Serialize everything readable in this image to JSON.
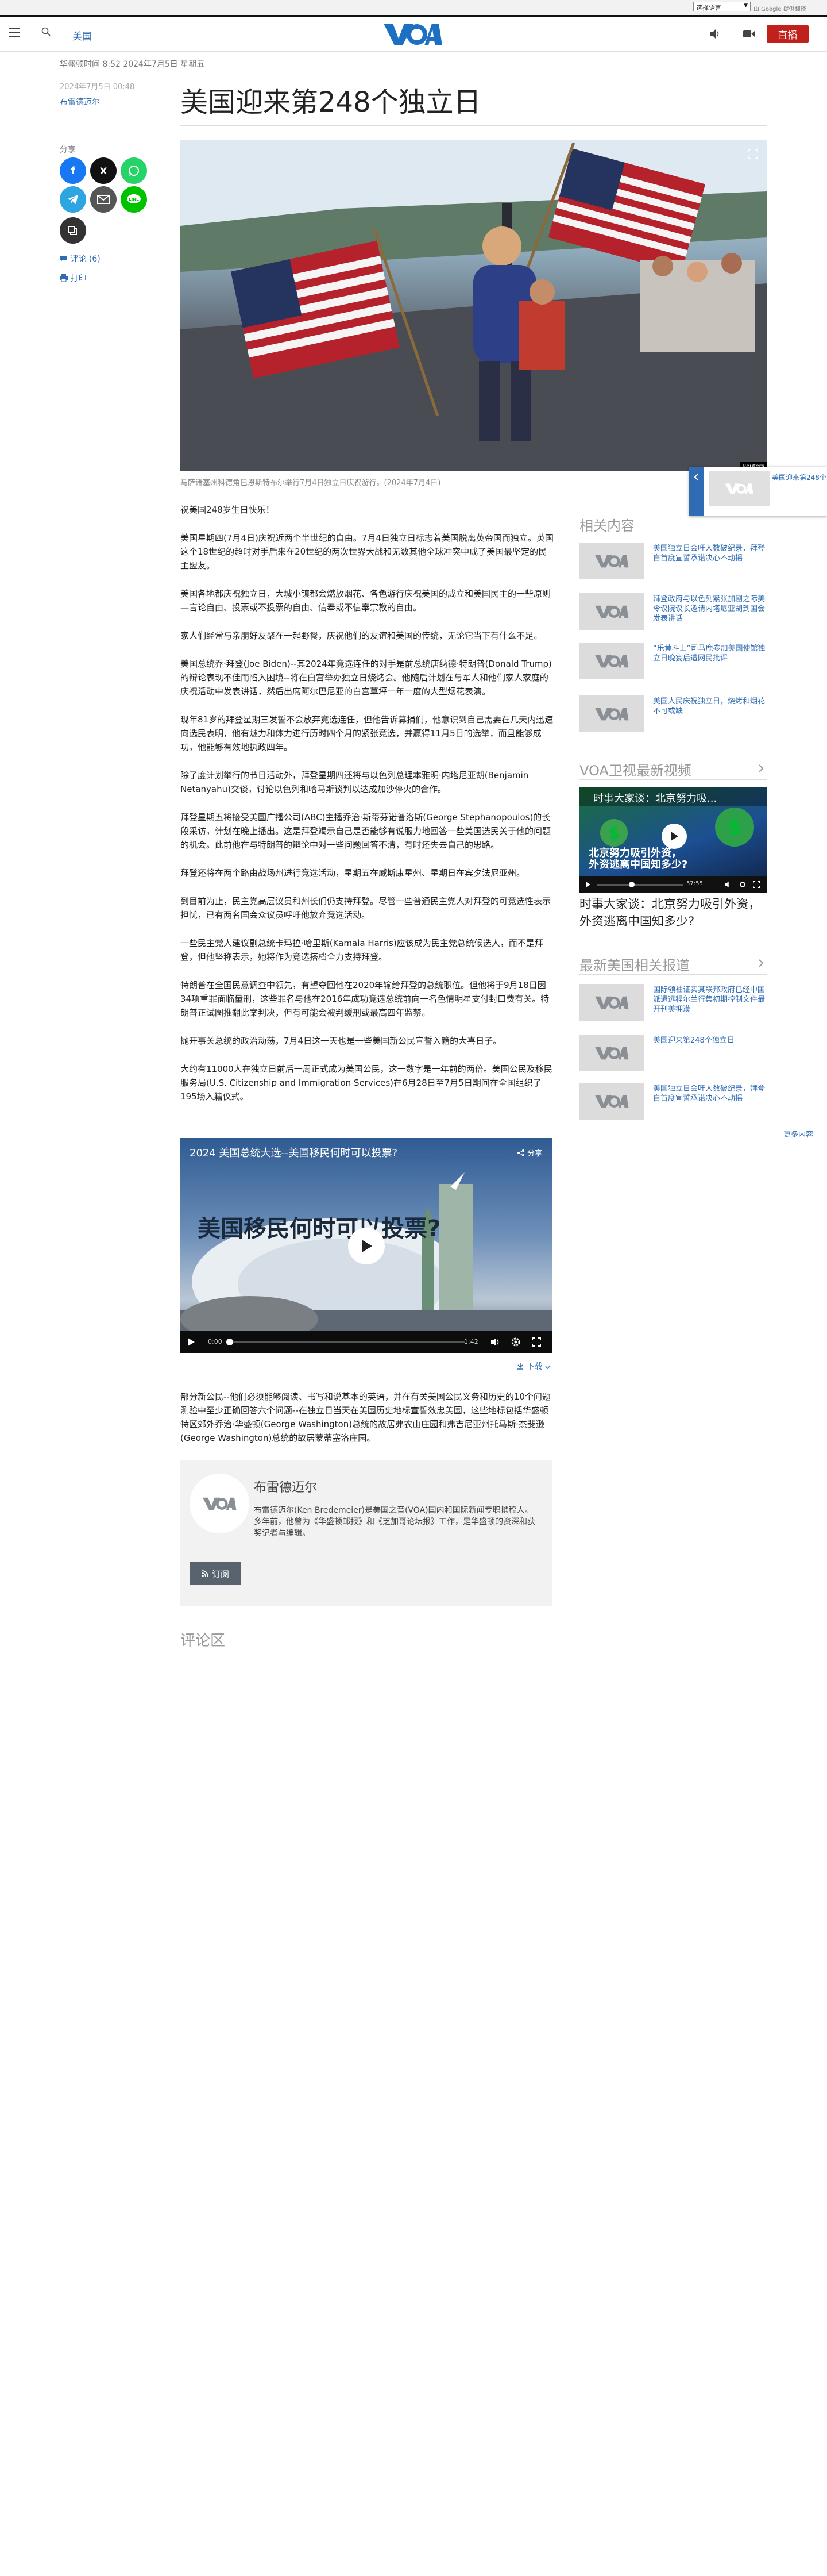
{
  "topbar": {
    "language_select": "选择语言",
    "powered_by": "由 Google 提供翻译"
  },
  "header": {
    "section": "美国",
    "live_label": "直播"
  },
  "article": {
    "meta_date": "华盛顿时间 8:52 2024年7月5日 星期五",
    "date": "2024年7月5日 00:48",
    "author": "布雷德迈尔",
    "title": "美国迎来第248个独立日",
    "share_label": "分享",
    "comments_link": "评论 (6)",
    "print_link": "打印",
    "image_caption": "马萨诸塞州科德角巴恩斯特布尔举行7月4日独立日庆祝游行。(2024年7月4日)",
    "image_credit": "Reuters",
    "paragraphs": [
      "祝美国248岁生日快乐！",
      "美国星期四(7月4日)庆祝近两个半世纪的自由。7月4日独立日标志着美国脱离英帝国而独立。英国这个18世纪的超时对手后来在20世纪的两次世界大战和无数其他全球冲突中成了美国最坚定的民主盟友。",
      "美国各地都庆祝独立日，大城小镇都会燃放烟花、各色游行庆祝美国的成立和美国民主的一些原则—言论自由、投票或不投票的自由、信奉或不信奉宗教的自由。",
      "家人们经常与亲朋好友聚在一起野餐，庆祝他们的友谊和美国的传统，无论它当下有什么不足。",
      "美国总统乔·拜登(Joe Biden)--其2024年竞选连任的对手是前总统唐纳德·特朗普(Donald Trump)的辩论表现不佳而陷入困境--将在白宫举办独立日烧烤会。他随后计划在与军人和他们家人家庭的庆祝活动中发表讲话，然后出席阿尔巴尼亚的白宫草坪一年一度的大型烟花表演。",
      "现年81岁的拜登星期三发誓不会放弃竞选连任，但他告诉募捐们，他意识到自己需要在几天内迅速向选民表明，他有魅力和体力进行历时四个月的紧张竞选，并赢得11月5日的选举，而且能够成功，他能够有效地执政四年。",
      "除了度计划举行的节日活动外，拜登星期四还将与以色列总理本雅明·内塔尼亚胡(Benjamin Netanyahu)交谈，讨论以色列和哈马斯谈判以达成加沙停火的合作。",
      "拜登星期五将接受美国广播公司(ABC)主播乔治·斯蒂芬诺普洛斯(George Stephanopoulos)的长段采访，计划在晚上播出。这是拜登竭示自己是否能够有说服力地回答一些美国选民关于他的问题的机会。此前他在与特朗普的辩论中对一些问题回答不清，有时还失去自己的思路。",
      "拜登还将在两个路由战场州进行竞选活动，星期五在威斯康星州、星期日在宾夕法尼亚州。",
      "到目前为止，民主党高层议员和州长们仍支持拜登。尽管一些普通民主党人对拜登的可竞选性表示担忧，已有两名国会众议员呼吁他放弃竞选活动。",
      "一些民主党人建议副总统卡玛拉·哈里斯(Kamala Harris)应该成为民主党总统候选人，而不是拜登，但他坚称表示，她将作为竞选搭档全力支持拜登。",
      "特朗普在全国民意调查中领先，有望夺回他在2020年输给拜登的总统职位。但他将于9月18日因34项重罪面临量刑，这些罪名与他在2016年成功竞选总统前向一名色情明星支付封口费有关。特朗普正试图推翻此案判决，但有可能会被判缓刑或最高四年监禁。",
      "抛开事关总统的政治动荡，7月4日这一天也是一些美国新公民宣誓入籍的大喜日子。",
      "大约有11000人在独立日前后一周正式成为美国公民，这一数字是一年前的两倍。美国公民及移民服务局(U.S. Citizenship and Immigration Services)在6月28日至7月5日期间在全国组织了195场入籍仪式。"
    ],
    "video_title": "2024 美国总统大选--美国移民何时可以投票?",
    "video_overlay_text": "美国移民何时可以投票?",
    "video_share": "分享",
    "video_time_start": "0:00",
    "video_time_end": "1:42",
    "download_label": "下载",
    "outro": "部分新公民--他们必须能够阅读、书写和说基本的英语，并在有关美国公民义务和历史的10个问题测验中至少正确回答六个问题--在独立日当天在美国历史地标宣誓效忠美国，这些地标包括华盛顿特区郊外乔治·华盛顿(George Washington)总统的故居弗农山庄园和弗吉尼亚州托马斯·杰斐逊(George Washington)总统的故居蒙蒂塞洛庄园。",
    "author_card": {
      "name": "布雷德迈尔",
      "bio": "布雷德迈尔(Ken Bredemeier)是美国之音(VOA)国内和国际新闻专职撰稿人。多年前，他曾为《华盛顿邮报》和《芝加哥论坛报》工作，是华盛顿的资深和获奖记者与编辑。",
      "subscribe": "订阅"
    },
    "comments_title": "评论区"
  },
  "float_card": {
    "title": "美国迎来第248个"
  },
  "sidebar": {
    "related_title": "相关内容",
    "related": [
      "美国独立日会吁人数破纪录，拜登自首度宣誓承诺决心不动摇",
      "拜登政府与以色列紧张加剧之际美令议院议长邀请内塔尼亚胡到国会发表讲话",
      "“乐黄斗士”司马鹿参加美国使馆独立日晚宴后遭网民批评",
      "美国人民庆祝独立日，烧烤和烟花不可或缺"
    ],
    "video_section_title": "VOA卫视最新视频",
    "video": {
      "banner": "时事大家谈：北京努力吸...",
      "overlay_line1": "北京努力吸引外资，",
      "overlay_line2": "外资逃离中国知多少?",
      "time": "57:55",
      "caption": "时事大家谈：北京努力吸引外资，外资逃离中国知多少?"
    },
    "latest_title": "最新美国相关报道",
    "latest": [
      "国际领袖证实其联邦政府已经中国派遣远程尔兰行集初期控制文件最开刊美拥漠",
      "美国迎来第248个独立日",
      "美国独立日会吁人数破纪录，拜登自首度宣誓承诺决心不动摇"
    ],
    "more_link": "更多内容"
  },
  "colors": {
    "voa_blue": "#2f6cb3",
    "live_red": "#c0211c",
    "facebook": "#1877f2",
    "x": "#111111",
    "whatsapp": "#25d366",
    "telegram": "#2ca5e0",
    "email": "#555555",
    "line": "#00c300",
    "copy": "#333333"
  }
}
